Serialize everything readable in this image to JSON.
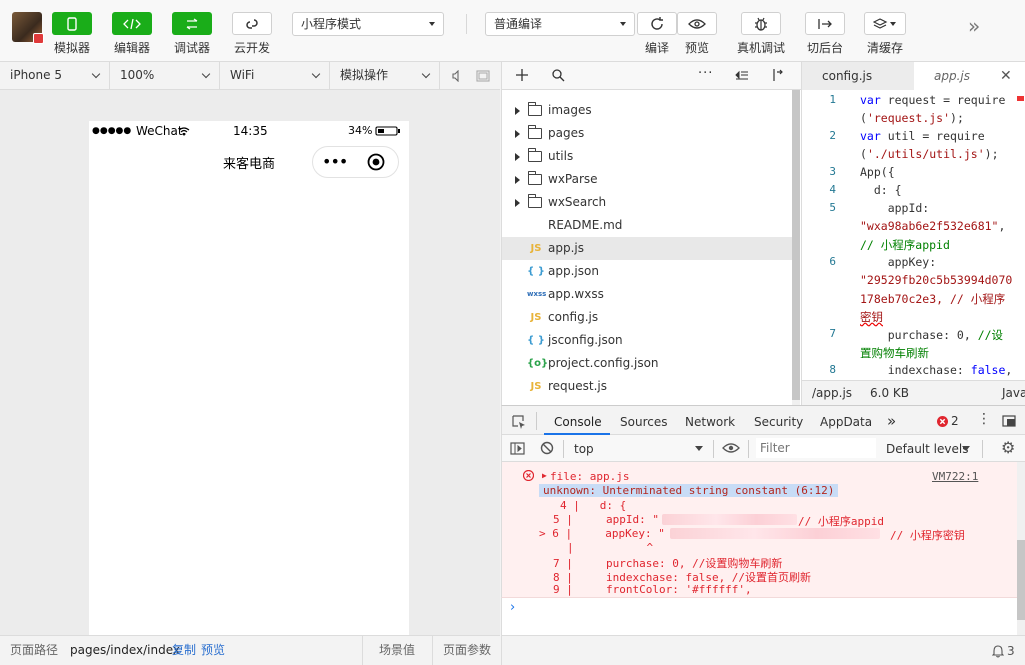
{
  "toolbar": {
    "buttons": [
      {
        "label": "模拟器",
        "icon": "phone-icon"
      },
      {
        "label": "编辑器",
        "icon": "code-icon"
      },
      {
        "label": "调试器",
        "icon": "debug-arrows-icon"
      },
      {
        "label": "云开发",
        "icon": "cloud-link-icon"
      }
    ],
    "mode_select": "小程序模式",
    "compile_select": "普通编译",
    "actions": [
      {
        "label": "编译",
        "icon": "refresh-icon"
      },
      {
        "label": "预览",
        "icon": "eye-icon"
      },
      {
        "label": "真机调试",
        "icon": "bug-icon"
      },
      {
        "label": "切后台",
        "icon": "switch-background-icon"
      },
      {
        "label": "清缓存",
        "icon": "layers-icon"
      }
    ],
    "more": "»"
  },
  "device_bar": {
    "device": "iPhone 5",
    "zoom": "100%",
    "network": "WiFi",
    "operation": "模拟操作"
  },
  "phone": {
    "signal": "●●●●●",
    "carrier": "WeChat",
    "time": "14:35",
    "battery": "34%",
    "title": "来客电商",
    "capsule_dots": "•••"
  },
  "sim_footer": {
    "path_label": "页面路径",
    "path": "pages/index/index",
    "copy": "复制",
    "preview": "预览",
    "scene": "场景值",
    "params": "页面参数"
  },
  "explorer": {
    "items": [
      {
        "name": "images",
        "type": "folder"
      },
      {
        "name": "pages",
        "type": "folder"
      },
      {
        "name": "utils",
        "type": "folder"
      },
      {
        "name": "wxParse",
        "type": "folder"
      },
      {
        "name": "wxSearch",
        "type": "folder"
      },
      {
        "name": "README.md",
        "type": "file",
        "icon": "",
        "color": "#333333"
      },
      {
        "name": "app.js",
        "type": "file",
        "icon": "JS",
        "color": "#e8b339"
      },
      {
        "name": "app.json",
        "type": "file",
        "icon": "{ }",
        "color": "#3b9bd1"
      },
      {
        "name": "app.wxss",
        "type": "file",
        "icon": "wxss",
        "color": "#2f6fb8"
      },
      {
        "name": "config.js",
        "type": "file",
        "icon": "JS",
        "color": "#e8b339"
      },
      {
        "name": "jsconfig.json",
        "type": "file",
        "icon": "{ }",
        "color": "#3b9bd1"
      },
      {
        "name": "project.config.json",
        "type": "file",
        "icon": "{o}",
        "color": "#2aa24a"
      },
      {
        "name": "request.js",
        "type": "file",
        "icon": "JS",
        "color": "#e8b339"
      }
    ],
    "active": "app.js"
  },
  "editor": {
    "tabs": [
      "config.js",
      "app.js"
    ],
    "active_tab": "app.js",
    "status_file": "/app.js",
    "status_size": "6.0 KB",
    "status_lang": "Java"
  },
  "devtools": {
    "tabs": [
      "Console",
      "Sources",
      "Network",
      "Security",
      "AppData"
    ],
    "more": "»",
    "error_count": "2",
    "context": "top",
    "filter_placeholder": "Filter",
    "levels": "Default levels",
    "error_file": "file: app.js",
    "error_source": "VM722:1",
    "error_message": "unknown: Unterminated string constant (6:12)"
  },
  "colors": {
    "accent_green": "#1aad19",
    "error_red": "#e0262f",
    "console_bg": "#fff0f0"
  }
}
